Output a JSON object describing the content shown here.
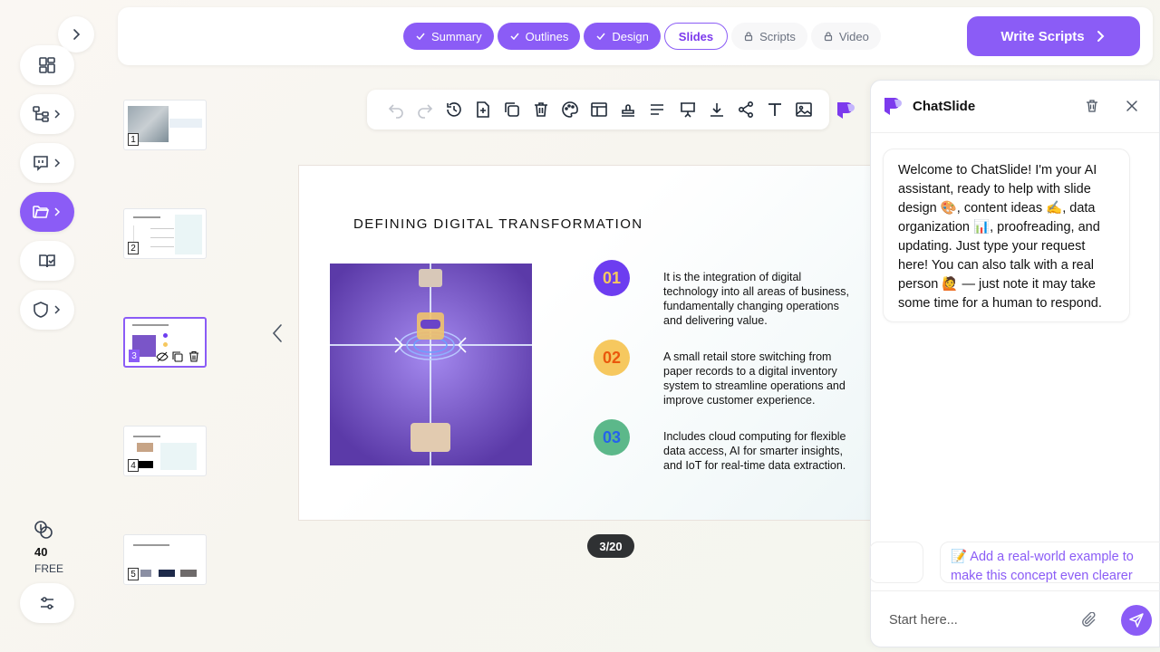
{
  "topbar": {
    "steps": [
      {
        "label": "Summary",
        "state": "done"
      },
      {
        "label": "Outlines",
        "state": "done"
      },
      {
        "label": "Design",
        "state": "done"
      },
      {
        "label": "Slides",
        "state": "current"
      },
      {
        "label": "Scripts",
        "state": "locked"
      },
      {
        "label": "Video",
        "state": "locked"
      }
    ],
    "write_button_label": "Write Scripts"
  },
  "sidebar": {
    "credits_value": "40",
    "plan_label": "FREE",
    "items": [
      "dashboard-icon",
      "outline-tree-icon",
      "chat-icon",
      "folder-icon",
      "book-check-icon",
      "shield-icon"
    ]
  },
  "thumbnails": [
    {
      "num": "1"
    },
    {
      "num": "2"
    },
    {
      "num": "3"
    },
    {
      "num": "4"
    },
    {
      "num": "5"
    }
  ],
  "slide": {
    "title": "DEFINING DIGITAL TRANSFORMATION",
    "points": [
      {
        "num": "01",
        "text": "It is the integration of digital technology into all areas of business, fundamentally changing operations and delivering value."
      },
      {
        "num": "02",
        "text": "A small retail store switching from paper records to a digital inventory system to streamline operations and improve customer experience."
      },
      {
        "num": "03",
        "text": "Includes cloud computing for flexible data access, AI for smarter insights, and IoT for real-time data extraction."
      }
    ]
  },
  "pagination": {
    "label": "3/20"
  },
  "chat": {
    "title": "ChatSlide",
    "welcome": "Welcome to ChatSlide! I'm your AI assistant, ready to help with slide design 🎨, content ideas ✍️, data organization 📊, proofreading, and updating. Just type your request here! You can also talk with a real person 🙋 — just note it may take some time for a human to respond.",
    "suggestion": "📝 Add a real-world example to make this concept even clearer",
    "input_placeholder": "Start here..."
  },
  "colors": {
    "accent": "#8b5cf6",
    "num1": "#6d3df0",
    "num2": "#f6c85f",
    "num3": "#5cb88a"
  }
}
